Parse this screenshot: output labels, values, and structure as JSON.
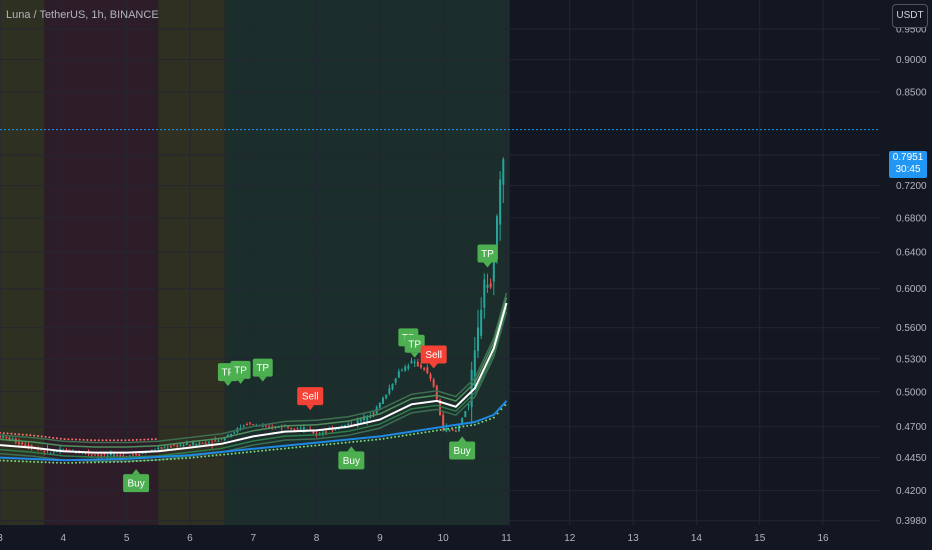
{
  "header": {
    "symbol": "Luna / TetherUS, 1h, BINANCE",
    "currency": "USDT"
  },
  "price_tag": {
    "price": "0.7951",
    "countdown": "30:45"
  },
  "colors": {
    "background": "#131722",
    "up": "#26a69a",
    "down": "#ef5350",
    "buy": "#4caf50",
    "sell": "#f44336",
    "price_line": "#2196f3"
  },
  "chart_data": {
    "type": "line",
    "y_scale": "log",
    "ylim": [
      0.395,
      1.0
    ],
    "xlim": [
      3.0,
      16.9
    ],
    "grid": true,
    "x_ticks": [
      {
        "v": 3,
        "label": "3"
      },
      {
        "v": 4,
        "label": "4"
      },
      {
        "v": 5,
        "label": "5"
      },
      {
        "v": 6,
        "label": "6"
      },
      {
        "v": 7,
        "label": "7"
      },
      {
        "v": 8,
        "label": "8"
      },
      {
        "v": 9,
        "label": "9"
      },
      {
        "v": 10,
        "label": "10"
      },
      {
        "v": 11,
        "label": "11"
      },
      {
        "v": 12,
        "label": "12"
      },
      {
        "v": 13,
        "label": "13"
      },
      {
        "v": 14,
        "label": "14"
      },
      {
        "v": 15,
        "label": "15"
      },
      {
        "v": 16,
        "label": "16"
      }
    ],
    "y_ticks": [
      {
        "v": 0.95,
        "label": "0.9500"
      },
      {
        "v": 0.9,
        "label": "0.9000"
      },
      {
        "v": 0.85,
        "label": "0.8500"
      },
      {
        "v": 0.76,
        "label": "0.7600"
      },
      {
        "v": 0.72,
        "label": "0.7200"
      },
      {
        "v": 0.68,
        "label": "0.6800"
      },
      {
        "v": 0.64,
        "label": "0.6400"
      },
      {
        "v": 0.6,
        "label": "0.6000"
      },
      {
        "v": 0.56,
        "label": "0.5600"
      },
      {
        "v": 0.53,
        "label": "0.5300"
      },
      {
        "v": 0.5,
        "label": "0.5000"
      },
      {
        "v": 0.47,
        "label": "0.4700"
      },
      {
        "v": 0.445,
        "label": "0.4450"
      },
      {
        "v": 0.42,
        "label": "0.4200"
      },
      {
        "v": 0.398,
        "label": "0.3980"
      }
    ],
    "last_price": 0.7951,
    "background_zones": [
      {
        "from": 3.0,
        "to": 3.7,
        "color": "#2e3122"
      },
      {
        "from": 3.7,
        "to": 5.5,
        "color": "#2d1d29"
      },
      {
        "from": 5.5,
        "to": 6.55,
        "color": "#2f3022"
      },
      {
        "from": 6.55,
        "to": 11.05,
        "color": "#1b2e2b"
      }
    ],
    "series": [
      {
        "key": "close",
        "values": [
          [
            3.0,
            0.462
          ],
          [
            3.2,
            0.459
          ],
          [
            3.4,
            0.455
          ],
          [
            3.6,
            0.452
          ],
          [
            3.8,
            0.449
          ],
          [
            4.0,
            0.451
          ],
          [
            4.3,
            0.449
          ],
          [
            4.6,
            0.447
          ],
          [
            4.9,
            0.446
          ],
          [
            5.2,
            0.448
          ],
          [
            5.5,
            0.452
          ],
          [
            5.8,
            0.455
          ],
          [
            6.1,
            0.456
          ],
          [
            6.4,
            0.458
          ],
          [
            6.7,
            0.466
          ],
          [
            6.9,
            0.473
          ],
          [
            7.2,
            0.469
          ],
          [
            7.5,
            0.471
          ],
          [
            7.8,
            0.468
          ],
          [
            8.0,
            0.464
          ],
          [
            8.3,
            0.469
          ],
          [
            8.6,
            0.473
          ],
          [
            8.9,
            0.482
          ],
          [
            9.1,
            0.498
          ],
          [
            9.3,
            0.518
          ],
          [
            9.5,
            0.527
          ],
          [
            9.7,
            0.521
          ],
          [
            9.85,
            0.505
          ],
          [
            10.0,
            0.468
          ],
          [
            10.2,
            0.466
          ],
          [
            10.4,
            0.49
          ],
          [
            10.55,
            0.556
          ],
          [
            10.65,
            0.612
          ],
          [
            10.75,
            0.6
          ],
          [
            10.85,
            0.68
          ],
          [
            10.95,
            0.766
          ],
          [
            11.0,
            0.795
          ]
        ]
      },
      {
        "key": "ema",
        "values": [
          [
            3.0,
            0.455
          ],
          [
            3.5,
            0.453
          ],
          [
            4.0,
            0.45
          ],
          [
            4.5,
            0.449
          ],
          [
            5.0,
            0.449
          ],
          [
            5.5,
            0.45
          ],
          [
            6.0,
            0.453
          ],
          [
            6.5,
            0.456
          ],
          [
            7.0,
            0.462
          ],
          [
            7.5,
            0.466
          ],
          [
            8.0,
            0.467
          ],
          [
            8.5,
            0.47
          ],
          [
            9.0,
            0.476
          ],
          [
            9.5,
            0.489
          ],
          [
            9.9,
            0.492
          ],
          [
            10.2,
            0.487
          ],
          [
            10.5,
            0.503
          ],
          [
            10.8,
            0.54
          ],
          [
            11.0,
            0.585
          ]
        ]
      },
      {
        "key": "support",
        "values": [
          [
            3.0,
            0.445
          ],
          [
            4.0,
            0.443
          ],
          [
            5.0,
            0.444
          ],
          [
            6.0,
            0.447
          ],
          [
            7.0,
            0.452
          ],
          [
            8.0,
            0.457
          ],
          [
            9.0,
            0.462
          ],
          [
            9.5,
            0.466
          ],
          [
            10.0,
            0.47
          ],
          [
            10.5,
            0.474
          ],
          [
            10.8,
            0.48
          ],
          [
            11.0,
            0.492
          ]
        ]
      }
    ],
    "signals": [
      {
        "type": "Buy",
        "x": 5.15,
        "y": 0.436,
        "pos": "below"
      },
      {
        "type": "TP",
        "x": 6.6,
        "y": 0.505,
        "pos": "above"
      },
      {
        "type": "TP",
        "x": 6.8,
        "y": 0.507,
        "pos": "above"
      },
      {
        "type": "TP",
        "x": 7.15,
        "y": 0.509,
        "pos": "above"
      },
      {
        "type": "Sell",
        "x": 7.9,
        "y": 0.484,
        "pos": "above"
      },
      {
        "type": "Buy",
        "x": 8.55,
        "y": 0.454,
        "pos": "below"
      },
      {
        "type": "TP",
        "x": 9.45,
        "y": 0.537,
        "pos": "above"
      },
      {
        "type": "TP",
        "x": 9.55,
        "y": 0.531,
        "pos": "above"
      },
      {
        "type": "Sell",
        "x": 9.85,
        "y": 0.521,
        "pos": "above"
      },
      {
        "type": "Buy",
        "x": 10.3,
        "y": 0.462,
        "pos": "below"
      },
      {
        "type": "TP",
        "x": 10.7,
        "y": 0.623,
        "pos": "above"
      }
    ]
  }
}
